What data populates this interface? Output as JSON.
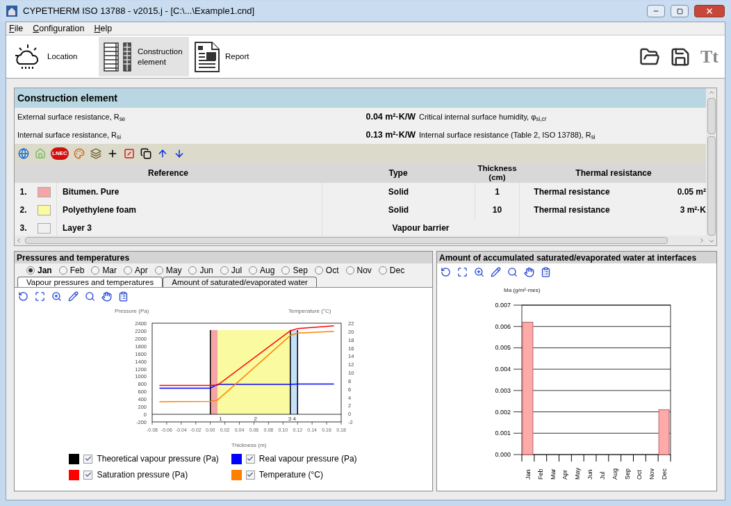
{
  "window": {
    "title": "CYPETHERM ISO 13788 - v2015.j - [C:\\...\\Example1.cnd]"
  },
  "menu": [
    {
      "label": "File"
    },
    {
      "label": "Configuration"
    },
    {
      "label": "Help"
    }
  ],
  "toolbar": [
    {
      "kind": "weather",
      "label": "Location",
      "selected": false
    },
    {
      "kind": "layers",
      "label": "Construction element",
      "selected": true
    },
    {
      "kind": "report",
      "label": "Report",
      "selected": false
    }
  ],
  "toolbar_right": {
    "font_label": "Tt"
  },
  "construction": {
    "title": "Construction element",
    "properties": [
      {
        "label": "External surface resistance, R$_{se}$",
        "value": "0.04 m²·K/W",
        "right_label": "Critical internal surface humidity, φ$_{si,cr}$"
      },
      {
        "label": "Internal surface resistance, R$_{si}$",
        "value": "0.13 m²·K/W",
        "right_label": "Internal surface resistance (Table 2, ISO 13788), R$_{si}$"
      }
    ],
    "lnec_label": "LNEC",
    "columns": [
      "Reference",
      "Type",
      "Thickness\n(cm)",
      "Thermal resistance"
    ],
    "rows": [
      {
        "number": "1.",
        "color": "#f4a6a6",
        "reference": "Bitumen. Pure",
        "type": "Solid",
        "thickness": "1",
        "resistance_label": "Thermal resistance",
        "resistance": "0.05 m²"
      },
      {
        "number": "2.",
        "color": "#fafaa0",
        "reference": "Polyethylene foam",
        "type": "Solid",
        "thickness": "10",
        "resistance_label": "Thermal resistance",
        "resistance": "3 m²·K"
      },
      {
        "number": "3.",
        "color": "#f0f0f0",
        "reference": "Layer 3",
        "type": "Vapour barrier"
      }
    ]
  },
  "pressures": {
    "title": "Pressures and temperatures",
    "months": [
      {
        "label": "Jan",
        "selected": true
      },
      {
        "label": "Feb",
        "selected": false
      },
      {
        "label": "Mar",
        "selected": false
      },
      {
        "label": "Apr",
        "selected": false
      },
      {
        "label": "May",
        "selected": false
      },
      {
        "label": "Jun",
        "selected": false
      },
      {
        "label": "Jul",
        "selected": false
      },
      {
        "label": "Aug",
        "selected": false
      },
      {
        "label": "Sep",
        "selected": false
      },
      {
        "label": "Oct",
        "selected": false
      },
      {
        "label": "Nov",
        "selected": false
      },
      {
        "label": "Dec",
        "selected": false
      }
    ],
    "tabs": [
      {
        "label": "Vapour pressures and temperatures",
        "selected": true
      },
      {
        "label": "Amount of saturated/evaporated water",
        "selected": false
      }
    ],
    "chart_data": {
      "type": "line",
      "ylabel": "Pressure (Pa)",
      "xlabel": "Thickness (m)",
      "x": [
        -0.07,
        0,
        0.01,
        0.11,
        0.12,
        0.17
      ],
      "series": [
        {
          "name": "Real vapour pressure (Pa)",
          "color": "#0000ff",
          "values": [
            690,
            690,
            790,
            790,
            800,
            800
          ]
        },
        {
          "name": "Saturation pressure (Pa)",
          "color": "#ff0000",
          "values": [
            760,
            760,
            770,
            2200,
            2260,
            2330
          ]
        }
      ],
      "xlim": [
        -0.08,
        0.18
      ],
      "ylim": [
        -200,
        2400
      ],
      "xticks": [
        {
          "value": -0.08,
          "label": "-0.08"
        },
        {
          "value": -0.06,
          "label": "-0.06"
        },
        {
          "value": -0.04,
          "label": "-0.04"
        },
        {
          "value": -0.02,
          "label": "-0.02"
        },
        {
          "value": 0,
          "label": "0.00"
        },
        {
          "value": 0.02,
          "label": "0.02"
        },
        {
          "value": 0.04,
          "label": "0.04"
        },
        {
          "value": 0.06,
          "label": "0.06"
        },
        {
          "value": 0.08,
          "label": "0.08"
        },
        {
          "value": 0.1,
          "label": "0.10"
        },
        {
          "value": 0.12,
          "label": "0.12"
        },
        {
          "value": 0.14,
          "label": "0.14"
        },
        {
          "value": 0.16,
          "label": "0.16"
        },
        {
          "value": 0.18,
          "label": "0.18"
        }
      ],
      "yticks": [
        -200,
        0,
        200,
        400,
        600,
        800,
        1000,
        1200,
        1400,
        1600,
        1800,
        2000,
        2200,
        2400
      ],
      "bands": [
        {
          "axis": "x",
          "from": 0,
          "to": 0.01,
          "color": "#f4a6a6",
          "label": "1"
        },
        {
          "axis": "x",
          "from": 0.01,
          "to": 0.11,
          "color": "#fafaa0",
          "label": "2"
        },
        {
          "axis": "x",
          "from": 0.11,
          "to": 0.12,
          "color": "#c6e0f8",
          "label": "3 4"
        }
      ],
      "ref_lines": [
        {
          "axis": "x",
          "value": 0
        },
        {
          "axis": "x",
          "value": 0.11
        },
        {
          "axis": "x",
          "value": 0.12
        }
      ]
    },
    "temperature": {
      "chart_data": {
        "type": "line",
        "ylabel": "Temperature (°C)",
        "x": [
          -0.07,
          0,
          0.01,
          0.11,
          0.12,
          0.17
        ],
        "series": [
          {
            "name": "Temperature (°C)",
            "color": "#ff8000",
            "values": [
              2.9,
              3,
              3.3,
              19,
              19.6,
              20
            ]
          }
        ],
        "xlim": [
          -0.08,
          0.18
        ],
        "ylim": [
          -2,
          22
        ],
        "yticks": [
          -2,
          0,
          2,
          4,
          6,
          8,
          10,
          12,
          14,
          16,
          18,
          20,
          22
        ]
      }
    },
    "legend": [
      {
        "color": "#000000",
        "checked": true,
        "label": "Theoretical vapour pressure (Pa)"
      },
      {
        "checked": true
      },
      {
        "checked": true
      },
      {
        "checked": true
      }
    ]
  },
  "water": {
    "title": "Amount of accumulated saturated/evaporated water at interfaces",
    "chart_data": {
      "type": "bar",
      "ylabel": "Ma (g/m²·mes)",
      "grid": true,
      "categories": [
        "Jan",
        "Feb",
        "Mar",
        "Apr",
        "May",
        "Jun",
        "Jul",
        "Aug",
        "Sep",
        "Oct",
        "Nov",
        "Dec"
      ],
      "series": [
        {
          "color": "#ffaaaa",
          "values": [
            0.0062,
            null,
            null,
            null,
            null,
            null,
            null,
            null,
            null,
            null,
            null,
            0.0021
          ]
        }
      ],
      "ylim": [
        0,
        0.007
      ],
      "yticks": [
        {
          "value": 0,
          "label": "0.000"
        },
        {
          "value": 0.001,
          "label": "0.001"
        },
        {
          "value": 0.002,
          "label": "0.002"
        },
        {
          "value": 0.003,
          "label": "0.003"
        },
        {
          "value": 0.004,
          "label": "0.004"
        },
        {
          "value": 0.005,
          "label": "0.005"
        },
        {
          "value": 0.006,
          "label": "0.006"
        },
        {
          "value": 0.007,
          "label": "0.007"
        }
      ]
    }
  }
}
